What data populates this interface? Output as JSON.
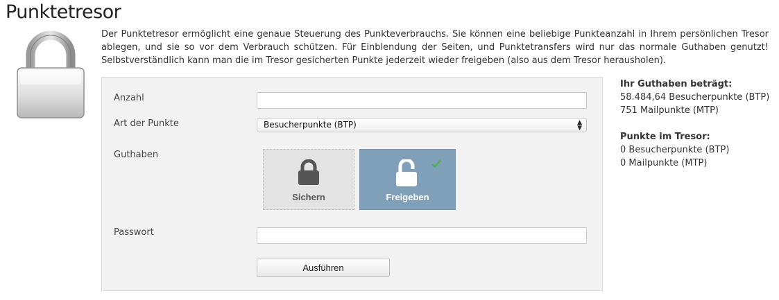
{
  "page": {
    "title": "Punktetresor",
    "intro": "Der Punktetresor ermöglicht eine genaue Steuerung des Punkteverbrauchs. Sie können eine beliebige Punkteanzahl in Ihrem persönlichen Tresor ablegen, und sie so vor dem Verbrauch schützen. Für Einblendung der Seiten, und Punktetransfers wird nur das normale Guthaben genutzt! Selbstverständlich kann man die im Tresor gesicherten Punkte jederzeit wieder freigeben (also aus dem Tresor herausholen)."
  },
  "form": {
    "amount_label": "Anzahl",
    "amount_value": "",
    "type_label": "Art der Punkte",
    "type_selected": "Besucherpunkte (BTP)",
    "balance_label": "Guthaben",
    "secure_label": "Sichern",
    "release_label": "Freigeben",
    "selected_action": "Freigeben",
    "password_label": "Passwort",
    "password_value": "",
    "submit_label": "Ausführen"
  },
  "sidebar": {
    "balance_heading": "Ihr Guthaben beträgt:",
    "balance_lines": [
      "58.484,64 Besucherpunkte (BTP)",
      "751 Mailpunkte (MTP)"
    ],
    "vault_heading": "Punkte im Tresor:",
    "vault_lines": [
      "0 Besucherpunkte (BTP)",
      "0 Mailpunkte (MTP)"
    ]
  },
  "colors": {
    "selected_tile": "#80a0ba",
    "check": "#4caf50"
  },
  "icons": {
    "hero": "padlock-icon",
    "secure": "lock-closed-icon",
    "release": "lock-open-icon",
    "selected": "checkmark-icon"
  }
}
